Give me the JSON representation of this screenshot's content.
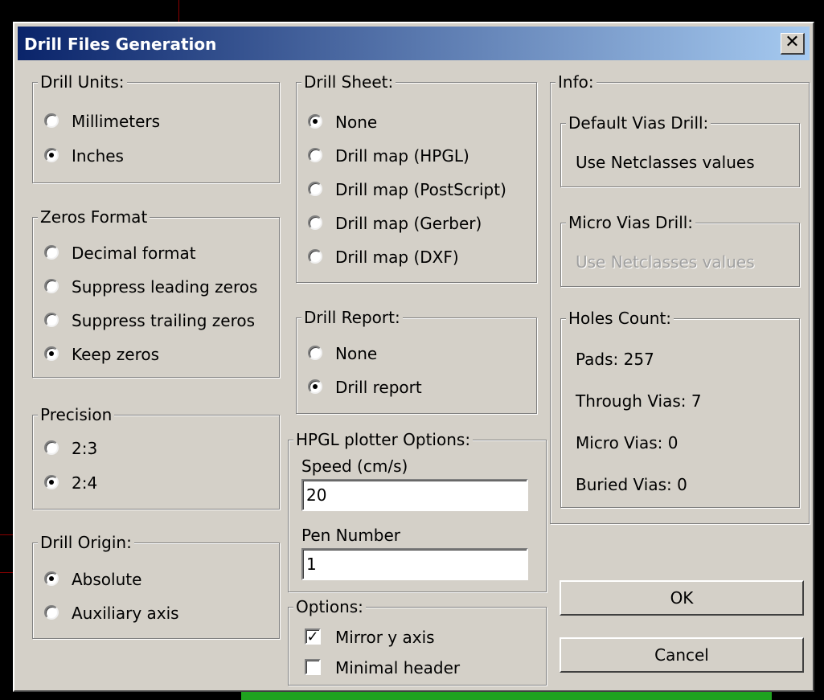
{
  "window": {
    "title": "Drill Files Generation",
    "close_glyph": "✕"
  },
  "drill_units": {
    "label": "Drill Units:",
    "options": [
      {
        "label": "Millimeters",
        "selected": false
      },
      {
        "label": "Inches",
        "selected": true
      }
    ]
  },
  "zeros_format": {
    "label": "Zeros Format",
    "options": [
      {
        "label": "Decimal format",
        "selected": false
      },
      {
        "label": "Suppress leading zeros",
        "selected": false
      },
      {
        "label": "Suppress trailing zeros",
        "selected": false
      },
      {
        "label": "Keep zeros",
        "selected": true
      }
    ]
  },
  "precision": {
    "label": "Precision",
    "options": [
      {
        "label": "2:3",
        "selected": false
      },
      {
        "label": "2:4",
        "selected": true
      }
    ]
  },
  "drill_origin": {
    "label": "Drill Origin:",
    "options": [
      {
        "label": "Absolute",
        "selected": true
      },
      {
        "label": "Auxiliary axis",
        "selected": false
      }
    ]
  },
  "drill_sheet": {
    "label": "Drill Sheet:",
    "options": [
      {
        "label": "None",
        "selected": true
      },
      {
        "label": "Drill map (HPGL)",
        "selected": false
      },
      {
        "label": "Drill map (PostScript)",
        "selected": false
      },
      {
        "label": "Drill map (Gerber)",
        "selected": false
      },
      {
        "label": "Drill map (DXF)",
        "selected": false
      }
    ]
  },
  "drill_report": {
    "label": "Drill Report:",
    "options": [
      {
        "label": "None",
        "selected": false
      },
      {
        "label": "Drill report",
        "selected": true
      }
    ]
  },
  "hpgl": {
    "label": "HPGL plotter Options:",
    "speed_label": "Speed (cm/s)",
    "speed_value": "20",
    "pen_label": "Pen Number",
    "pen_value": "1"
  },
  "options": {
    "label": "Options:",
    "checks": [
      {
        "label": "Mirror y axis",
        "checked": true
      },
      {
        "label": "Minimal header",
        "checked": false
      }
    ]
  },
  "info": {
    "label": "Info:",
    "default_vias": {
      "label": "Default Vias Drill:",
      "value": "Use Netclasses values"
    },
    "micro_vias": {
      "label": "Micro Vias Drill:",
      "value": "Use Netclasses values"
    },
    "holes": {
      "label": "Holes Count:",
      "pads": "Pads: 257",
      "through": "Through Vias: 7",
      "micro": "Micro Vias: 0",
      "buried": "Buried Vias: 0"
    }
  },
  "buttons": {
    "ok": "OK",
    "cancel": "Cancel"
  },
  "colors": {
    "dialog_bg": "#d4d0c8",
    "title_start": "#0a246a",
    "title_end": "#a6caf0"
  }
}
